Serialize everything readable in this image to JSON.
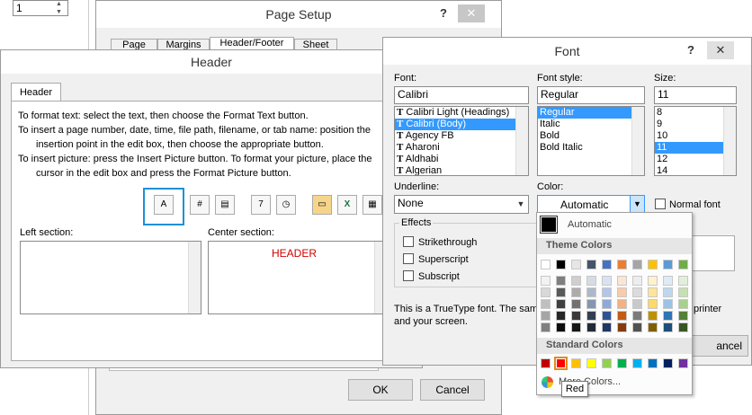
{
  "spinner_value": "1",
  "page_setup": {
    "title": "Page Setup",
    "help": "?",
    "close": "✕",
    "tabs": [
      "Page",
      "Margins",
      "Header/Footer",
      "Sheet"
    ],
    "ok": "OK",
    "cancel": "Cancel"
  },
  "header_dialog": {
    "title": "Header",
    "tab": "Header",
    "instr1": "To format text:  select the text, then choose the Format Text button.",
    "instr2": "To insert a page number, date, time, file path, filename, or tab name:  position the",
    "instr3": "insertion point in the edit box, then choose the appropriate button.",
    "instr4": "To insert picture: press the Insert Picture button.  To format your picture, place the",
    "instr5": "cursor in the edit box and press the Format Picture button.",
    "format_text_glyph": "A",
    "left_section": "Left section:",
    "center_section": "Center section:",
    "center_text": "HEADER"
  },
  "font_dialog": {
    "title": "Font",
    "help": "?",
    "close": "✕",
    "font_label": "Font:",
    "font_value": "Calibri",
    "font_list": [
      "Calibri Light (Headings)",
      "Calibri (Body)",
      "Agency FB",
      "Aharoni",
      "Aldhabi",
      "Algerian"
    ],
    "style_label": "Font style:",
    "style_value": "Regular",
    "style_list": [
      "Regular",
      "Italic",
      "Bold",
      "Bold Italic"
    ],
    "size_label": "Size:",
    "size_value": "11",
    "size_list": [
      "8",
      "9",
      "10",
      "11",
      "12",
      "14"
    ],
    "underline_label": "Underline:",
    "underline_value": "None",
    "color_label": "Color:",
    "color_value": "Automatic",
    "normal_font": "Normal font",
    "effects": "Effects",
    "strike": "Strikethrough",
    "super": "Superscript",
    "sub": "Subscript",
    "note1": "This is a TrueType font.  The sam",
    "note1b": "printer",
    "note2": "and your screen.",
    "cancel": "ancel"
  },
  "color_popup": {
    "automatic": "Automatic",
    "theme_colors": "Theme Colors",
    "standard_colors": "Standard Colors",
    "more_colors": "More Colors...",
    "tooltip": "Red",
    "theme_top": [
      "#ffffff",
      "#000000",
      "#e7e6e6",
      "#44546a",
      "#4472c4",
      "#ed7d31",
      "#a5a5a5",
      "#ffc000",
      "#5b9bd5",
      "#70ad47"
    ],
    "theme_shades": [
      [
        "#f2f2f2",
        "#7f7f7f",
        "#d0cece",
        "#d6dce4",
        "#d9e2f3",
        "#fbe5d5",
        "#ededed",
        "#fff2cc",
        "#deebf6",
        "#e2efd9"
      ],
      [
        "#d8d8d8",
        "#595959",
        "#aeabab",
        "#adb9ca",
        "#b4c6e7",
        "#f7cbac",
        "#dbdbdb",
        "#fee599",
        "#bdd7ee",
        "#c5e0b3"
      ],
      [
        "#bfbfbf",
        "#3f3f3f",
        "#757070",
        "#8496b0",
        "#8eaadb",
        "#f4b183",
        "#c9c9c9",
        "#ffd965",
        "#9cc3e5",
        "#a8d08d"
      ],
      [
        "#a5a5a5",
        "#262626",
        "#3a3838",
        "#323f4f",
        "#2f5496",
        "#c55a11",
        "#7b7b7b",
        "#bf9000",
        "#2e75b5",
        "#538135"
      ],
      [
        "#7f7f7f",
        "#0c0c0c",
        "#171616",
        "#222a35",
        "#1f3864",
        "#833c0b",
        "#525252",
        "#7f6000",
        "#1e4e79",
        "#375623"
      ]
    ],
    "standard": [
      "#c00000",
      "#ff0000",
      "#ffc000",
      "#ffff00",
      "#92d050",
      "#00b050",
      "#00b0f0",
      "#0070c0",
      "#002060",
      "#7030a0"
    ]
  }
}
